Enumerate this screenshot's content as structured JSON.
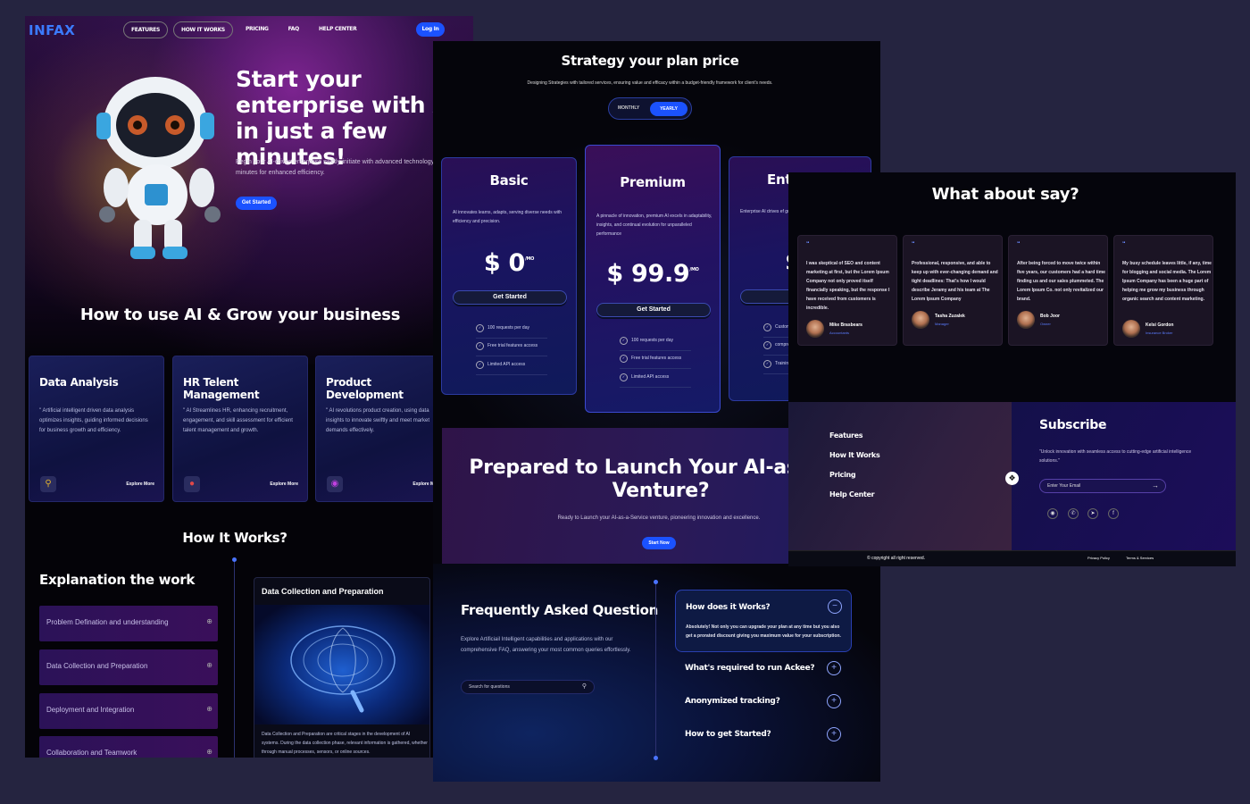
{
  "nav": {
    "logo": "INFAX",
    "links": [
      "FEATURES",
      "HOW IT WORKS",
      "PRICING",
      "FAQ",
      "HELP CENTER"
    ],
    "login": "Log In"
  },
  "hero": {
    "title": "Start your enterprise with AI in just a few minutes!",
    "subtitle": "Begin your AI-driven enterprise swiftly-initiate with advanced technology just a few minutes for enhanced efficiency.",
    "cta": "Get Started"
  },
  "howto": {
    "title": "How to use AI & Grow your business",
    "cards": [
      {
        "title": "Data Analysis",
        "text": "\" Artificial intelligent driven data analysis optimizes insights, guiding informed decisions for business growth and efficiency.",
        "more": "Explore More"
      },
      {
        "title": "HR Telent Management",
        "text": "\" AI Streamlines HR, enhancing recruitment, engagement, and skill assessment for efficient talent management and growth.",
        "more": "Explore More"
      },
      {
        "title": "Product Development",
        "text": "\" AI revolutions product creation, using data insights to innovate swiftly and meet market demands effectively.",
        "more": "Explore More"
      }
    ]
  },
  "how_it_works": {
    "title": "How It Works?",
    "explain_title": "Explanation the work",
    "items": [
      "Problem Defination and understanding",
      "Data Collection and Preparation",
      "Deployment and Integration",
      "Collaboration and Teamwork"
    ],
    "card_title": "Data Collection and Preparation",
    "card_text": "Data Collection and Preparation are critical stages in the development of AI systems. During the data collection phase, relevant information is gathered, whether through manual processes, sensors, or online sources."
  },
  "pricing": {
    "title": "Strategy your plan price",
    "subtitle": "Designing Strategies with tailored services, ensuring value and efficacy within a budget-friendly framework for client's needs.",
    "toggle_monthly": "MONTHLY",
    "toggle_yearly": "YEARLY",
    "plans": [
      {
        "name": "Basic",
        "desc": "AI innovates learns, adapts, serving diverse needs with efficiency and precision.",
        "price": "$ 0",
        "per": "/MO",
        "cta": "Get Started",
        "features": [
          "100 requests per day",
          "Free trial features access",
          "Limited API access"
        ]
      },
      {
        "name": "Premium",
        "desc": "A pinnacle of innovation, premium AI excels in adaptability, insights, and continual evolution for unparalleled performance",
        "price": "$ 99.9",
        "per": "/MO",
        "cta": "Get Started",
        "features": [
          "100 requests per day",
          "Free trial features access",
          "Limited API access"
        ]
      },
      {
        "name": "Ente",
        "desc": "Enterprise AI drives ef growth across diverse",
        "price": "$",
        "cta": "Co",
        "features": [
          "Custom",
          "compre",
          "Training"
        ]
      }
    ]
  },
  "launch": {
    "title_line1": "Prepared to Launch Your AI-as-a Se",
    "title_line2": "Venture?",
    "subtitle": "Ready to Launch your AI-as-a-Service venture, pioneering innovation and excellence.",
    "cta": "Start Now"
  },
  "faq": {
    "title": "Frequently Asked Question",
    "subtitle": "Explore Artificiail Intelligent capabilities and applications with our comprehensive FAQ, answering your most common queries effortlessly.",
    "search_placeholder": "Search for questions",
    "open_q": "How does it Works?",
    "open_a": "Absolutely! Not only you can upgrade your plan at any time but you also get a prorated discount giving you maximum value for your subscription.",
    "questions": [
      "What's required to run Ackee?",
      "Anonymized tracking?",
      "How to get Started?"
    ]
  },
  "testimonials": {
    "title": "What about say?",
    "items": [
      {
        "text": "I was skeptical of SEO and content marketing at first, but the Lorem Ipsum Company not only proved itself financially speaking, but the response I have received from customers is incredible.",
        "name": "Mike Brasbears",
        "role": "Accountants"
      },
      {
        "text": "Professional, responsive, and able to keep up with ever-changing demand and tight deadlines: That's how I would describe Jeramy and his team at The Lorem Ipsum Company",
        "name": "Tasha Zuzalek",
        "role": "Manager"
      },
      {
        "text": "After being forced to move twice within five years, our customers had a hard time finding us and our sales plummeted. The Lorem Ipsum Co. not only revitalized our brand.",
        "name": "Bob Joor",
        "role": "Owner"
      },
      {
        "text": "My busy schedule leaves little, if any, time for blogging and social media. The Lorem Ipsum Company has been a huge part of helping me grow my business through organic search and content marketing.",
        "name": "Kelsi Gordon",
        "role": "Insurance Broker"
      }
    ]
  },
  "footer": {
    "links": [
      "Features",
      "How It Works",
      "Pricing",
      "Help Center"
    ],
    "subscribe_title": "Subscribe",
    "subscribe_text": "\"Unlock innovation with seamless access to cutting-edge artificial intelligence solutions.\"",
    "email_placeholder": "Enter Your Email",
    "copyright": "© copyright all right reserved.",
    "privacy": "Privacy Policy",
    "terms": "Terms & Services"
  }
}
